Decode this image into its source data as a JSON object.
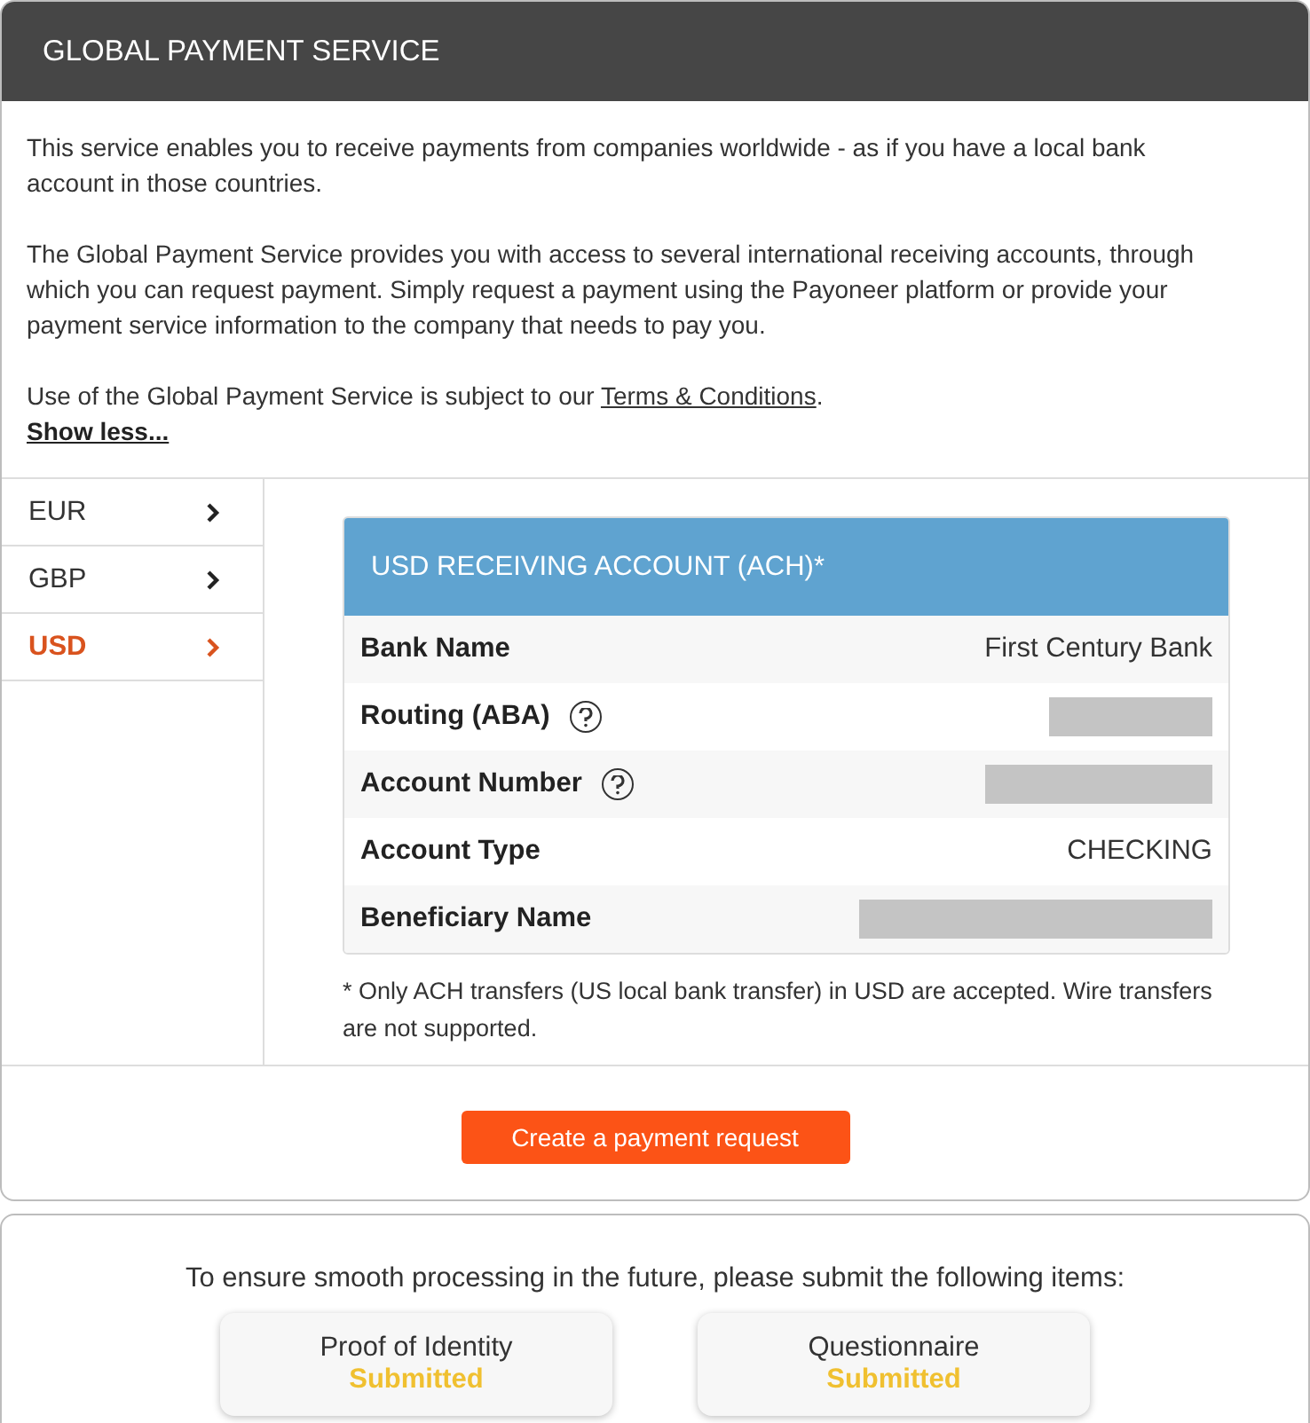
{
  "header": {
    "title": "GLOBAL PAYMENT SERVICE"
  },
  "intro": {
    "paragraphs": [
      "This service enables you to receive payments from companies worldwide - as if you have a local bank account in those countries.",
      "The Global Payment Service provides you with access to several international receiving accounts, through which you can request payment. Simply request a payment using the Payoneer platform or provide your payment service information to the company that needs to pay you."
    ],
    "terms_text": "Use of the Global Payment Service is subject to our",
    "terms_link": "Terms & Conditions",
    "terms_end": ".",
    "toggle": "Show less..."
  },
  "currencies": [
    {
      "label": "EUR",
      "selected": false
    },
    {
      "label": "GBP",
      "selected": false
    },
    {
      "label": "USD",
      "selected": true
    }
  ],
  "account": {
    "title": "USD RECEIVING ACCOUNT (ACH)*",
    "rows": [
      {
        "label": "Bank Name",
        "help": false,
        "kind": "text",
        "value": "First Century Bank"
      },
      {
        "label": "Routing (ABA)",
        "help": true,
        "kind": "redacted"
      },
      {
        "label": "Account Number",
        "help": true,
        "kind": "redacted"
      },
      {
        "label": "Account Type",
        "help": false,
        "kind": "text",
        "value": "CHECKING"
      },
      {
        "label": "Beneficiary Name",
        "help": false,
        "kind": "redacted"
      }
    ],
    "note": "* Only ACH transfers (US local bank transfer) in USD are accepted. Wire transfers are not supported."
  },
  "action": "Create a payment request",
  "requirements": {
    "prompt": "To ensure smooth processing in the future, please submit the following items:",
    "items": [
      {
        "name": "Proof of Identity",
        "status": "Submitted"
      },
      {
        "name": "Questionnaire",
        "status": "Submitted"
      }
    ]
  }
}
